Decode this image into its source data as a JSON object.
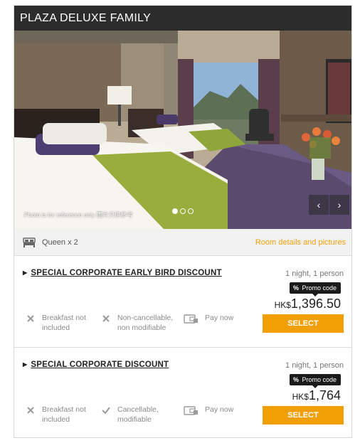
{
  "room": {
    "title": "PLAZA DELUXE FAMILY",
    "photo_caption": "Photo is for reference only 圖片只供參考",
    "carousel_dots": 3,
    "carousel_active": 1,
    "bed": "Queen x 2",
    "details_link": "Room details and pictures"
  },
  "colors": {
    "header_bg": "#2c2c2c",
    "accent": "#f29f05",
    "link": "#f0a10d"
  },
  "offers": [
    {
      "title": "SPECIAL CORPORATE EARLY BIRD DISCOUNT",
      "occupancy": "1 night, 1 person",
      "promo_symbol": "%",
      "promo": "Promo code",
      "currency": "HK$",
      "price": "1,396.50",
      "select": "SELECT",
      "features": [
        {
          "icon": "x-icon",
          "text": "Breakfast not included"
        },
        {
          "icon": "x-icon",
          "text": "Non-cancellable, non modifiable"
        },
        {
          "icon": "wallet-icon",
          "text": "Pay now"
        }
      ]
    },
    {
      "title": "SPECIAL CORPORATE DISCOUNT",
      "occupancy": "1 night, 1 person",
      "promo_symbol": "%",
      "promo": "Promo code",
      "currency": "HK$",
      "price": "1,764",
      "select": "SELECT",
      "features": [
        {
          "icon": "x-icon",
          "text": "Breakfast not included"
        },
        {
          "icon": "check-icon",
          "text": "Cancellable, modifiable"
        },
        {
          "icon": "wallet-icon",
          "text": "Pay now"
        }
      ]
    }
  ]
}
